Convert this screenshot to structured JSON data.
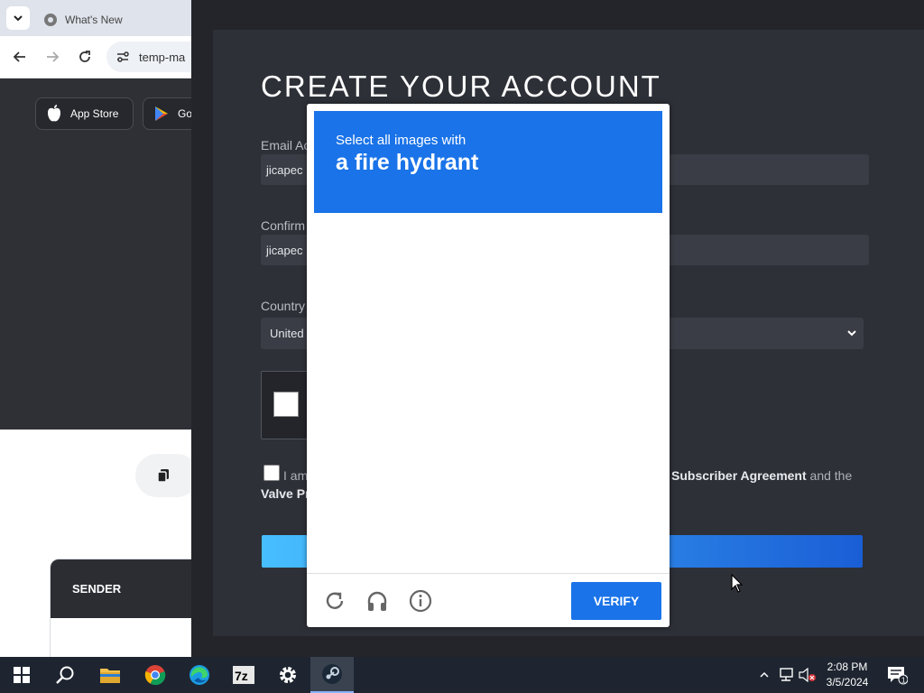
{
  "browser": {
    "tab_title": "What's New",
    "url_text": "temp-ma",
    "store_buttons": [
      {
        "label": "App Store"
      },
      {
        "label": "Go"
      }
    ],
    "sender_header": "SENDER"
  },
  "steam_form": {
    "title": "CREATE YOUR ACCOUNT",
    "email_label": "Email Ac",
    "email_value": "jicapec",
    "confirm_label": "Confirm",
    "confirm_value": "jicapec",
    "country_label": "Country",
    "country_value": "United",
    "agree_prefix": "I am",
    "agree_link1": "Subscriber Agreement",
    "agree_mid": "and the",
    "agree_line2": "Valve Pr"
  },
  "captcha": {
    "prompt": "Select all images with",
    "target": "a fire hydrant",
    "verify_label": "VERIFY",
    "header_color": "#1a73e8"
  },
  "taskbar": {
    "icons": [
      "windows-start-icon",
      "search-icon",
      "file-explorer-icon",
      "chrome-icon",
      "edge-icon",
      "7zip-icon",
      "settings-icon",
      "steam-icon"
    ],
    "time": "2:08 PM",
    "date": "3/5/2024",
    "notification_count": "1"
  }
}
